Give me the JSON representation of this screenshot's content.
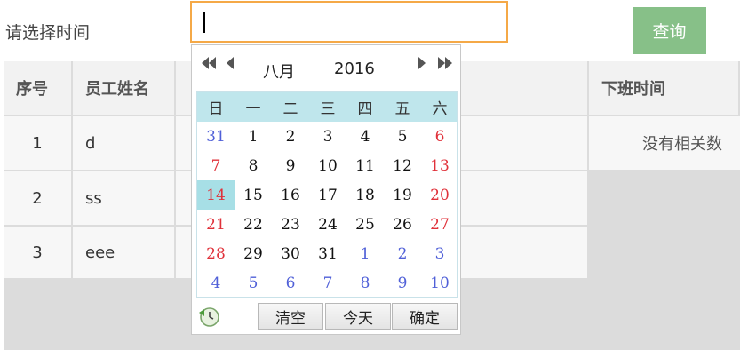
{
  "query": {
    "label": "请选择时间",
    "input_value": "",
    "button_label": "查询"
  },
  "table": {
    "headers": [
      "序号",
      "员工姓名",
      "",
      "下班时间"
    ],
    "rows": [
      {
        "index": "1",
        "name": "d"
      },
      {
        "index": "2",
        "name": "ss"
      },
      {
        "index": "3",
        "name": "eee"
      }
    ],
    "empty_text": "没有相关数"
  },
  "calendar": {
    "month": "八月",
    "year": "2016",
    "weekdays": [
      "日",
      "一",
      "二",
      "三",
      "四",
      "五",
      "六"
    ],
    "weeks": [
      [
        "31",
        "1",
        "2",
        "3",
        "4",
        "5",
        "6"
      ],
      [
        "7",
        "8",
        "9",
        "10",
        "11",
        "12",
        "13"
      ],
      [
        "14",
        "15",
        "16",
        "17",
        "18",
        "19",
        "20"
      ],
      [
        "21",
        "22",
        "23",
        "24",
        "25",
        "26",
        "27"
      ],
      [
        "28",
        "29",
        "30",
        "31",
        "1",
        "2",
        "3"
      ],
      [
        "4",
        "5",
        "6",
        "7",
        "8",
        "9",
        "10"
      ]
    ],
    "selected_day": "14",
    "buttons": {
      "clear": "清空",
      "today": "今天",
      "confirm": "确定"
    },
    "colors": {
      "header_bg": "#bfe6ec",
      "today_bg": "#a7dfe6",
      "weekend": "#e0313a",
      "other_month": "#5060d8"
    },
    "icons": {
      "prev_year": "double-left-arrow",
      "prev_month": "left-arrow",
      "next_month": "right-arrow",
      "next_year": "double-right-arrow",
      "time": "clock-icon"
    }
  },
  "colors": {
    "accent_button": "#87c088",
    "input_border": "#f5a947",
    "table_bg": "#dcdcdc"
  }
}
